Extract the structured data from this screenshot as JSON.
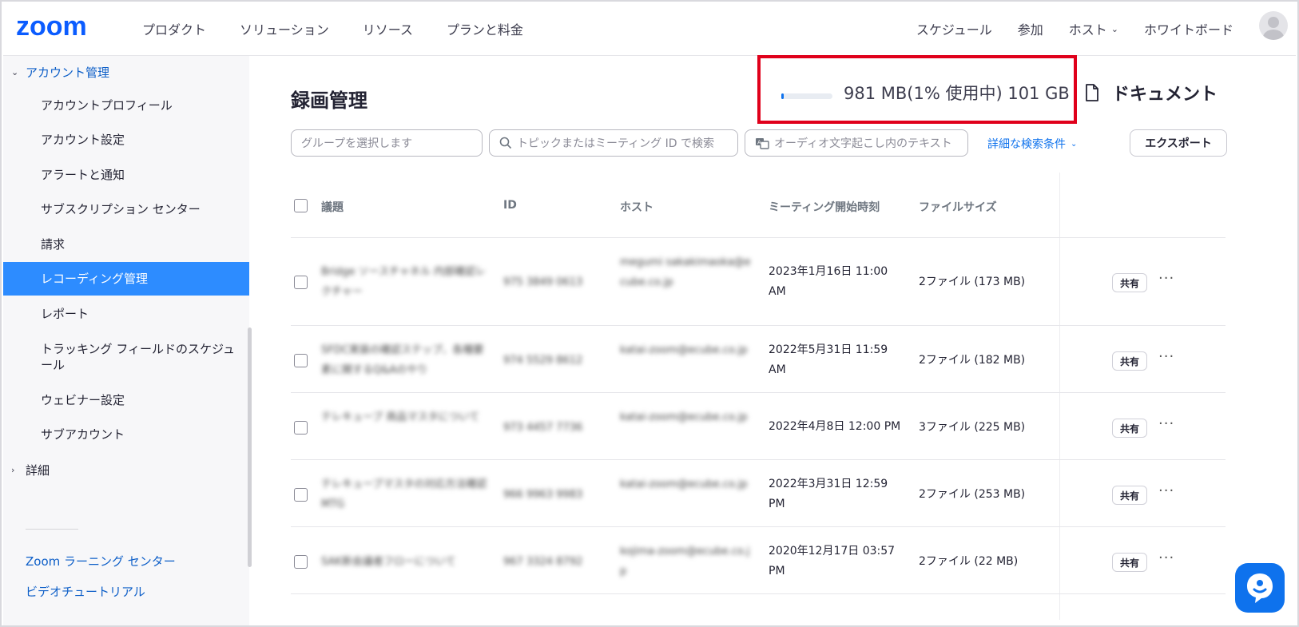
{
  "brand": {
    "logo_text": "zoom",
    "color": "#0b5cff"
  },
  "topnav": {
    "left": [
      "プロダクト",
      "ソリューション",
      "リソース",
      "プランと料金"
    ],
    "right": {
      "schedule": "スケジュール",
      "join": "参加",
      "host": "ホスト",
      "whiteboard": "ホワイトボード"
    }
  },
  "sidebar": {
    "section_account": "アカウント管理",
    "items": [
      "アカウントプロフィール",
      "アカウント設定",
      "アラートと通知",
      "サブスクリプション センター",
      "請求",
      "レコーディング管理",
      "レポート",
      "トラッキング フィールドのスケジュール",
      "ウェビナー設定",
      "サブアカウント"
    ],
    "section_details": "詳細",
    "links": [
      "Zoom ラーニング センター",
      "ビデオチュートリアル"
    ]
  },
  "main": {
    "title": "録画管理",
    "storage": {
      "used_text": "981 MB(1% 使用中) 101 GB",
      "used_fraction": 0.01
    },
    "docs_label": "ドキュメント",
    "filters": {
      "group_placeholder": "グループを選択します",
      "topic_placeholder": "トピックまたはミーティング ID で検索",
      "transcript_placeholder": "オーディオ文字起こし内のテキスト",
      "advanced": "詳細な検索条件",
      "export": "エクスポート"
    },
    "columns": {
      "topic": "議題",
      "id": "ID",
      "host": "ホスト",
      "start": "ミーティング開始時刻",
      "size": "ファイルサイズ"
    },
    "share_label": "共有",
    "more_label": "···",
    "rows": [
      {
        "topic": "Bridge ソースチャネル 内部確認レクチャー",
        "id": "975 3849 0613",
        "host": "megumi sakakimaoka@ecube.co.jp",
        "start": "2023年1月16日 11:00 AM",
        "size": "2ファイル (173 MB)"
      },
      {
        "topic": "SFDC実装の確認ステップ、各種要素に関するQ&Aのやり",
        "id": "974 5529 8612",
        "host": "katai-zoom@ecube.co.jp",
        "start": "2022年5月31日 11:59 AM",
        "size": "2ファイル (182 MB)"
      },
      {
        "topic": "テレキューブ 商品マスタについて",
        "id": "973 4457 7736",
        "host": "katai-zoom@ecube.co.jp",
        "start": "2022年4月8日 12:00 PM",
        "size": "3ファイル (225 MB)"
      },
      {
        "topic": "テレキューブマスタの対応方法確認MTG",
        "id": "966 9963 9983",
        "host": "katai-zoom@ecube.co.jp",
        "start": "2022年3月31日 12:59 PM",
        "size": "2ファイル (253 MB)"
      },
      {
        "topic": "SAK新会議者フローについて",
        "id": "967 3324 8792",
        "host": "kojima-zoom@ecube.co.jp",
        "start": "2020年12月17日 03:57 PM",
        "size": "2ファイル (22 MB)"
      }
    ]
  }
}
